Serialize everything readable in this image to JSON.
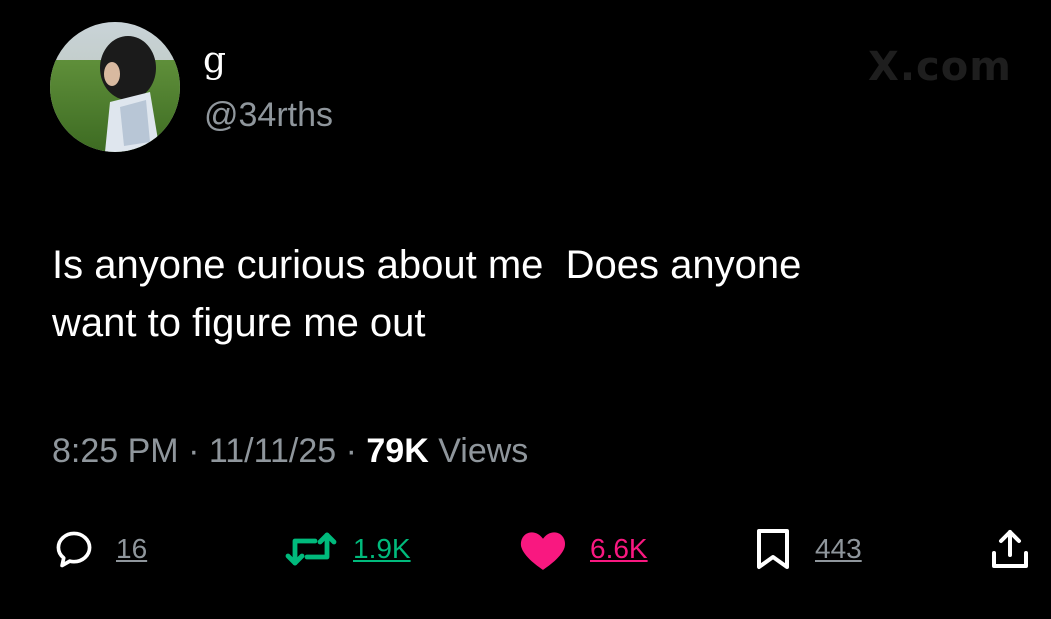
{
  "watermark": "X.com",
  "author": {
    "display_name": "g",
    "handle": "@34rths",
    "avatar_icon": "profile-photo"
  },
  "tweet": {
    "text_lines": [
      "Is anyone curious about me  Does anyone",
      "want to figure me out"
    ],
    "time": "8:25 PM",
    "date": "11/11/25",
    "separator": " · ",
    "views_count": "79K",
    "views_label": " Views"
  },
  "actions": {
    "reply": {
      "icon": "reply-icon",
      "count": "16",
      "color": "#8f969c"
    },
    "retweet": {
      "icon": "retweet-icon",
      "count": "1.9K",
      "color": "#00ba7c"
    },
    "like": {
      "icon": "heart-icon",
      "count": "6.6K",
      "color": "#f91880",
      "active": true
    },
    "bookmark": {
      "icon": "bookmark-icon",
      "count": "443",
      "color": "#8f969c"
    },
    "share": {
      "icon": "share-icon"
    }
  },
  "colors": {
    "background": "#000000",
    "text_primary": "#ffffff",
    "text_secondary": "#8f969c",
    "retweet_green": "#00ba7c",
    "like_pink": "#f91880"
  }
}
